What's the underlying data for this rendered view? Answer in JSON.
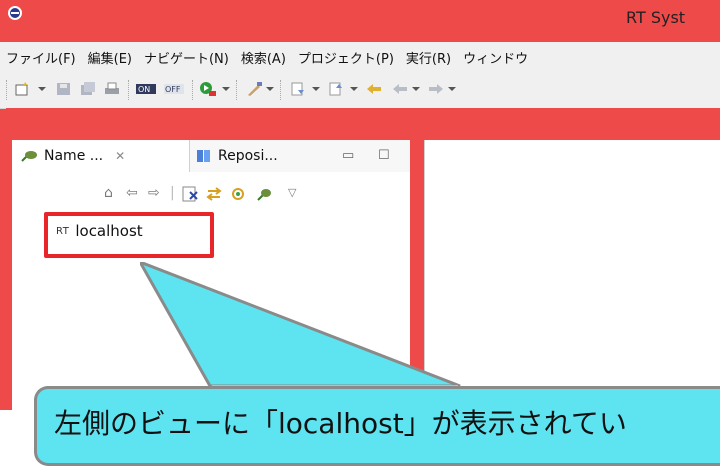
{
  "window": {
    "title": "RT Syst"
  },
  "menu": [
    "ファイル(F)",
    "編集(E)",
    "ナビゲート(N)",
    "検索(A)",
    "プロジェクト(P)",
    "実行(R)",
    "ウィンドウ"
  ],
  "tabs": {
    "name_service": "Name ...",
    "repository": "Reposi..."
  },
  "tree": {
    "tag": "RT",
    "item": "localhost"
  },
  "callout": {
    "text": "左側のビューに「localhost」が表示されてい"
  },
  "colors": {
    "frame": "#ef4a4a",
    "highlight": "#e8262a",
    "callout": "#5ee3f0"
  }
}
